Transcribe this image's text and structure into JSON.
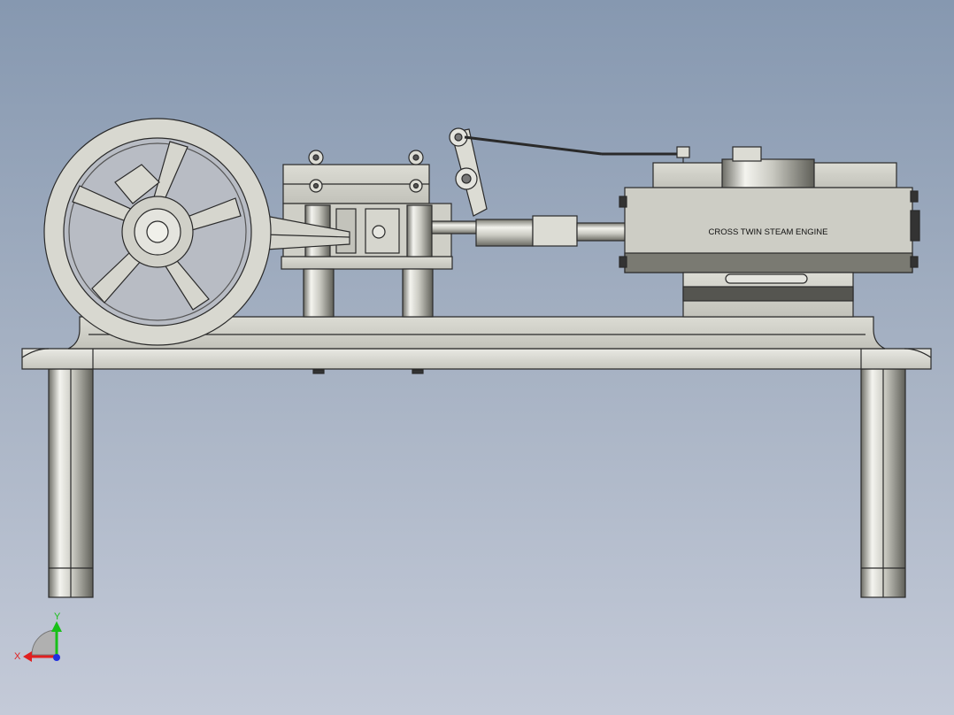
{
  "model": {
    "nameplate_text": "CROSS TWIN STEAM ENGINE"
  },
  "triad": {
    "x_label": "X",
    "y_label": "Y",
    "x_color": "#e02020",
    "y_color": "#18c018",
    "z_color": "#2030e0"
  },
  "colors": {
    "metal_light": "#e4e4de",
    "metal_mid": "#c9c9c1",
    "metal_dark": "#7a7a72",
    "outline": "#2a2a2a",
    "background_top": "#8698b0",
    "background_bottom": "#c4cad8"
  }
}
